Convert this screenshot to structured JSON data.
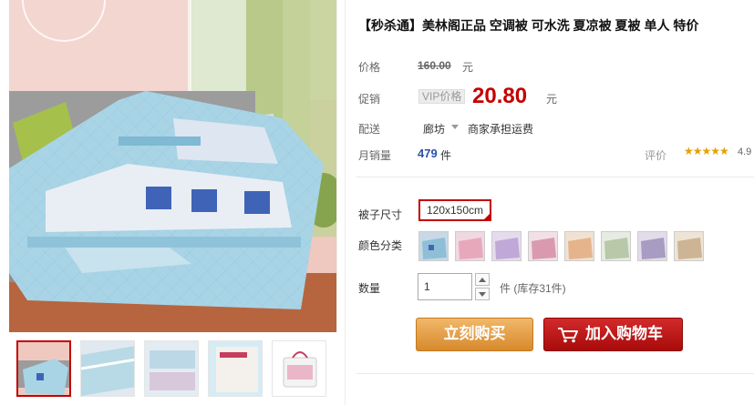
{
  "product": {
    "title": "【秒杀通】美林阁正品 空调被 可水洗 夏凉被 夏被 单人 特价"
  },
  "price": {
    "label": "价格",
    "original": "160.00",
    "unit": "元"
  },
  "promo": {
    "label": "促销",
    "tag": "VIP价格",
    "price": "20.80",
    "unit": "元"
  },
  "delivery": {
    "label": "配送",
    "location": "廊坊",
    "shipping": "商家承担运费"
  },
  "sales": {
    "label": "月销量",
    "count": "479",
    "unit": "件",
    "rating_label": "评价",
    "stars": "★★★★★",
    "rating": "4.9"
  },
  "options": {
    "size_label": "被子尺寸",
    "size_value": "120x150cm",
    "color_label": "颜色分类",
    "swatches": [
      {
        "color": "#c9d8e6"
      },
      {
        "color": "#e8b8c8"
      },
      {
        "color": "#c8b8dc"
      },
      {
        "color": "#e0b0c0"
      },
      {
        "color": "#e6c8a8"
      },
      {
        "color": "#cfd8c8"
      },
      {
        "color": "#c8c0d6"
      },
      {
        "color": "#d8c8b0"
      }
    ]
  },
  "quantity": {
    "label": "数量",
    "value": "1",
    "stock": "件 (库存31件)"
  },
  "actions": {
    "buy_label": "立刻购买",
    "cart_label": "加入购物车"
  },
  "colors": {
    "accent_red": "#c40000",
    "buy_orange": "#d8892c",
    "cart_red": "#a80b0b"
  }
}
